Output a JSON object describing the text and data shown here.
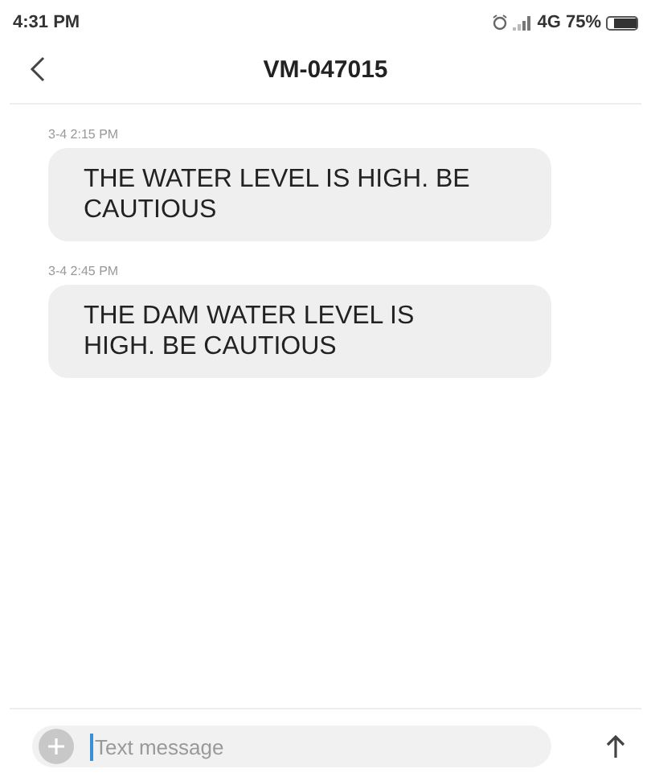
{
  "status_bar": {
    "time": "4:31 PM",
    "network": "4G",
    "battery": "75%"
  },
  "header": {
    "title": "VM-047015"
  },
  "messages": [
    {
      "time": "3-4 2:15 PM",
      "text": "THE WATER LEVEL IS HIGH. BE CAUTIOUS"
    },
    {
      "time": "3-4 2:45 PM",
      "text": "THE DAM WATER LEVEL IS HIGH. BE CAUTIOUS"
    }
  ],
  "composer": {
    "placeholder": "Text message"
  }
}
